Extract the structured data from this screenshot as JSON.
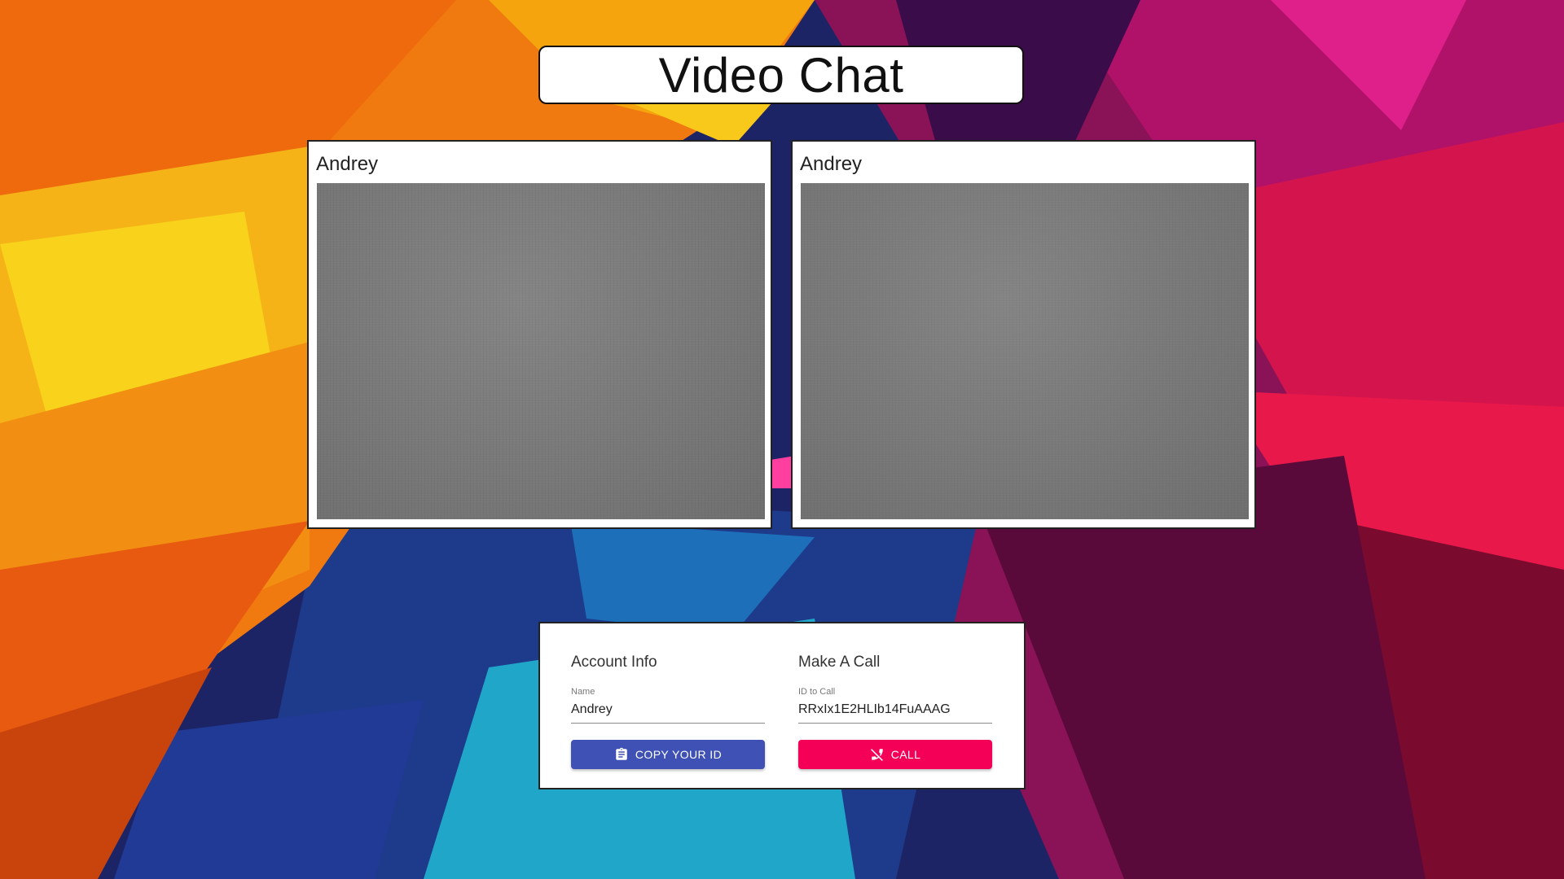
{
  "app": {
    "title": "Video Chat"
  },
  "videos": [
    {
      "name": "Andrey"
    },
    {
      "name": "Andrey"
    }
  ],
  "account": {
    "heading": "Account Info",
    "name_label": "Name",
    "name_value": "Andrey",
    "copy_button_label": "COPY YOUR ID",
    "copy_button_icon": "clipboard-icon"
  },
  "make_call": {
    "heading": "Make A Call",
    "id_label": "ID to Call",
    "id_value": "RRxIx1E2HLIb14FuAAAG",
    "call_button_label": "CALL",
    "call_button_icon": "phone-disabled-icon"
  },
  "colors": {
    "copy_button": "#3f51b5",
    "call_button": "#f50057"
  }
}
